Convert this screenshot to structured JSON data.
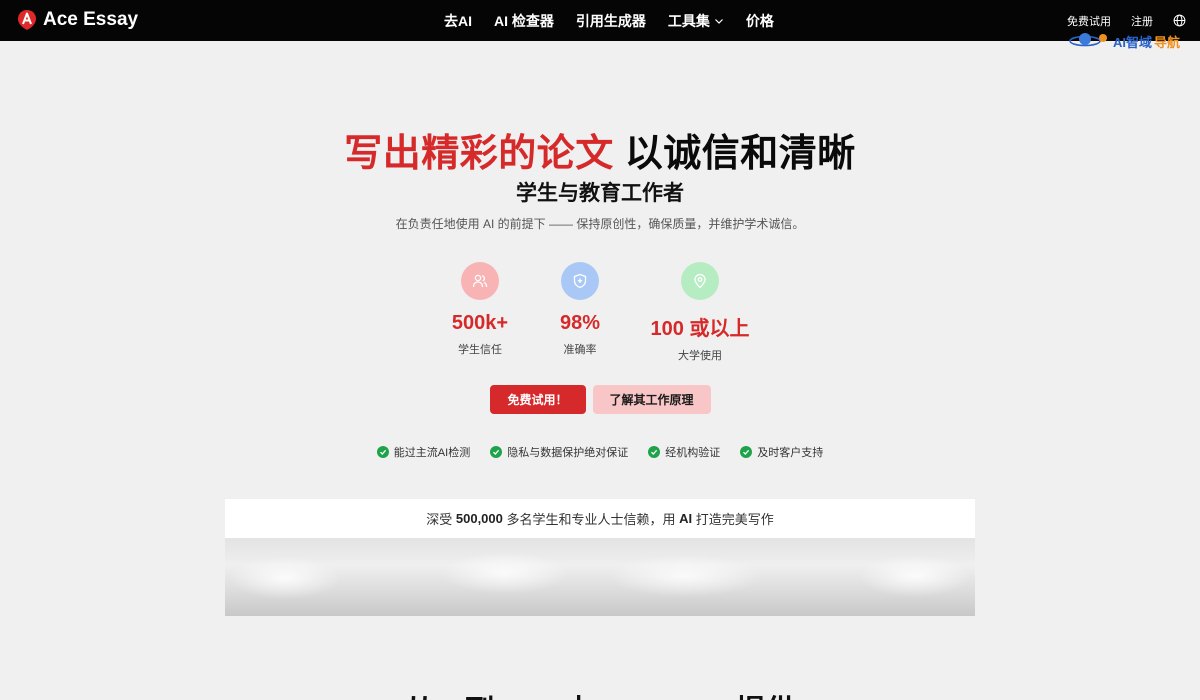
{
  "nav": {
    "brand": "Ace Essay",
    "items": [
      {
        "label": "去AI"
      },
      {
        "label": "AI 检查器"
      },
      {
        "label": "引用生成器"
      },
      {
        "label": "工具集"
      },
      {
        "label": "价格"
      }
    ],
    "free_trial": "免费试用",
    "register": "注册",
    "icons": {
      "logo": "ace-essay-logo-icon",
      "language": "globe-icon",
      "dropdown": "chevron-down-icon"
    }
  },
  "watermark": {
    "text_blue": "AI智域",
    "text_orange": "导航"
  },
  "hero": {
    "title_red": "写出精彩的论文",
    "title_dark": "以诚信和清晰",
    "subtitle": "学生与教育工作者",
    "description": "在负责任地使用 AI 的前提下 —— 保持原创性，确保质量，并维护学术诚信。"
  },
  "stats": [
    {
      "value": "500k+",
      "label": "学生信任",
      "icon": "users-icon",
      "color": "#f8b4b4"
    },
    {
      "value": "98%",
      "label": "准确率",
      "icon": "shield-icon",
      "color": "#a9c8f5"
    },
    {
      "value": "100 或以上",
      "label": "大学使用",
      "icon": "location-pin-icon",
      "color": "#b6ecc2"
    }
  ],
  "cta": {
    "primary": "免费试用！",
    "secondary": "了解其工作原理"
  },
  "features": [
    {
      "label": "能过主流AI检测"
    },
    {
      "label": "隐私与数据保护绝对保证"
    },
    {
      "label": "经机构验证"
    },
    {
      "label": "及时客户支持"
    }
  ],
  "trust": {
    "prefix": "深受 ",
    "count": "500,000",
    "middle": " 多名学生和专业人士信赖，用 ",
    "ai": "AI",
    "suffix": " 打造完美写作"
  },
  "bottom_heading": "从AI到A+，由AceEssay提供",
  "colors": {
    "accent": "#d6292b",
    "nav_bg": "#050505",
    "success": "#1fa34a"
  }
}
